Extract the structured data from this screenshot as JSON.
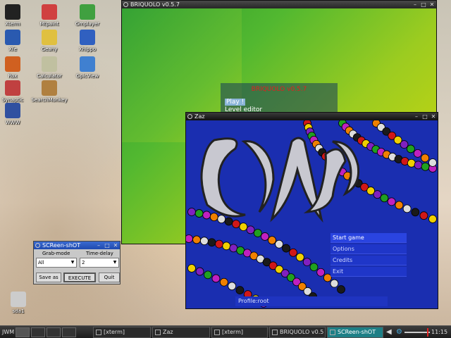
{
  "desktop_icons": [
    {
      "label": "Xterm",
      "color": "#222222"
    },
    {
      "label": "Mtpaint",
      "color": "#d04040"
    },
    {
      "label": "Gmplayer",
      "color": "#40a040"
    },
    {
      "label": "Xfe",
      "color": "#2a5ab0"
    },
    {
      "label": "Geany",
      "color": "#e0c040"
    },
    {
      "label": "Xhippo",
      "color": "#3060c0"
    },
    {
      "label": "Rox",
      "color": "#d06020"
    },
    {
      "label": "Calculator",
      "color": "#c0c0a0"
    },
    {
      "label": "GpicView",
      "color": "#4080d0"
    },
    {
      "label": "Synaptic",
      "color": "#c04040"
    },
    {
      "label": "SearchMonkey",
      "color": "#b08040"
    },
    {
      "label": "WWW",
      "color": "#3050a0"
    },
    {
      "label": "sda1",
      "color": "#cccccc"
    }
  ],
  "windows": {
    "briquolo": {
      "title": "BRIQUOLO v0.5.7",
      "menu_title": "BRIQUOLO v0.5.7",
      "items": [
        "Play !",
        "Level editor"
      ]
    },
    "zaz": {
      "title": "Zaz",
      "menu": [
        "Start game",
        "Options",
        "Credits",
        "Exit"
      ],
      "profile": "Profile:root",
      "logo": "ZAZ"
    },
    "screenshot": {
      "title": "SCReen-shOT",
      "grab_mode_label": "Grab-mode",
      "time_delay_label": "Time-delay",
      "grab_mode_value": "All",
      "time_delay_value": "2",
      "save_as": "Save as",
      "execute": "EXECUTE",
      "quit": "Quit"
    }
  },
  "taskbar": {
    "start": "JWM",
    "tasks": [
      "[xterm]",
      "Zaz",
      "[xterm]",
      "BRIQUOLO v0.5",
      "SCReen-shOT"
    ],
    "active_task": "SCReen-shOT",
    "clock": "11:15"
  },
  "colors": {
    "zaz_bg": "#1a2eb0",
    "briquolo_title": "#e02020",
    "taskbar_active": "#1d7f86"
  }
}
